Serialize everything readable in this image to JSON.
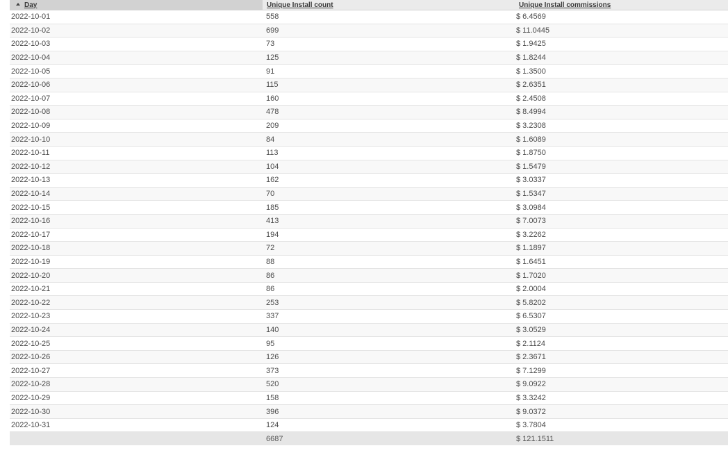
{
  "headers": {
    "day": "Day",
    "count": "Unique Install count",
    "commissions": "Unique Install commissions"
  },
  "rows": [
    {
      "day": "2022-10-01",
      "count": "558",
      "commissions": "$ 6.4569"
    },
    {
      "day": "2022-10-02",
      "count": "699",
      "commissions": "$ 11.0445"
    },
    {
      "day": "2022-10-03",
      "count": "73",
      "commissions": "$ 1.9425"
    },
    {
      "day": "2022-10-04",
      "count": "125",
      "commissions": "$ 1.8244"
    },
    {
      "day": "2022-10-05",
      "count": "91",
      "commissions": "$ 1.3500"
    },
    {
      "day": "2022-10-06",
      "count": "115",
      "commissions": "$ 2.6351"
    },
    {
      "day": "2022-10-07",
      "count": "160",
      "commissions": "$ 2.4508"
    },
    {
      "day": "2022-10-08",
      "count": "478",
      "commissions": "$ 8.4994"
    },
    {
      "day": "2022-10-09",
      "count": "209",
      "commissions": "$ 3.2308"
    },
    {
      "day": "2022-10-10",
      "count": "84",
      "commissions": "$ 1.6089"
    },
    {
      "day": "2022-10-11",
      "count": "113",
      "commissions": "$ 1.8750"
    },
    {
      "day": "2022-10-12",
      "count": "104",
      "commissions": "$ 1.5479"
    },
    {
      "day": "2022-10-13",
      "count": "162",
      "commissions": "$ 3.0337"
    },
    {
      "day": "2022-10-14",
      "count": "70",
      "commissions": "$ 1.5347"
    },
    {
      "day": "2022-10-15",
      "count": "185",
      "commissions": "$ 3.0984"
    },
    {
      "day": "2022-10-16",
      "count": "413",
      "commissions": "$ 7.0073"
    },
    {
      "day": "2022-10-17",
      "count": "194",
      "commissions": "$ 3.2262"
    },
    {
      "day": "2022-10-18",
      "count": "72",
      "commissions": "$ 1.1897"
    },
    {
      "day": "2022-10-19",
      "count": "88",
      "commissions": "$ 1.6451"
    },
    {
      "day": "2022-10-20",
      "count": "86",
      "commissions": "$ 1.7020"
    },
    {
      "day": "2022-10-21",
      "count": "86",
      "commissions": "$ 2.0004"
    },
    {
      "day": "2022-10-22",
      "count": "253",
      "commissions": "$ 5.8202"
    },
    {
      "day": "2022-10-23",
      "count": "337",
      "commissions": "$ 6.5307"
    },
    {
      "day": "2022-10-24",
      "count": "140",
      "commissions": "$ 3.0529"
    },
    {
      "day": "2022-10-25",
      "count": "95",
      "commissions": "$ 2.1124"
    },
    {
      "day": "2022-10-26",
      "count": "126",
      "commissions": "$ 2.3671"
    },
    {
      "day": "2022-10-27",
      "count": "373",
      "commissions": "$ 7.1299"
    },
    {
      "day": "2022-10-28",
      "count": "520",
      "commissions": "$ 9.0922"
    },
    {
      "day": "2022-10-29",
      "count": "158",
      "commissions": "$ 3.3242"
    },
    {
      "day": "2022-10-30",
      "count": "396",
      "commissions": "$ 9.0372"
    },
    {
      "day": "2022-10-31",
      "count": "124",
      "commissions": "$ 3.7804"
    }
  ],
  "totals": {
    "day": "",
    "count": "6687",
    "commissions": "$ 121.1511"
  },
  "sort": {
    "column": "day",
    "direction": "ascending",
    "icon": "sort-ascending-icon"
  },
  "colors": {
    "sorted_header_bg": "#d2d2d2",
    "header_bg": "#ebebeb",
    "total_row_bg": "#e6e6e6",
    "text": "#4a4a4a"
  }
}
